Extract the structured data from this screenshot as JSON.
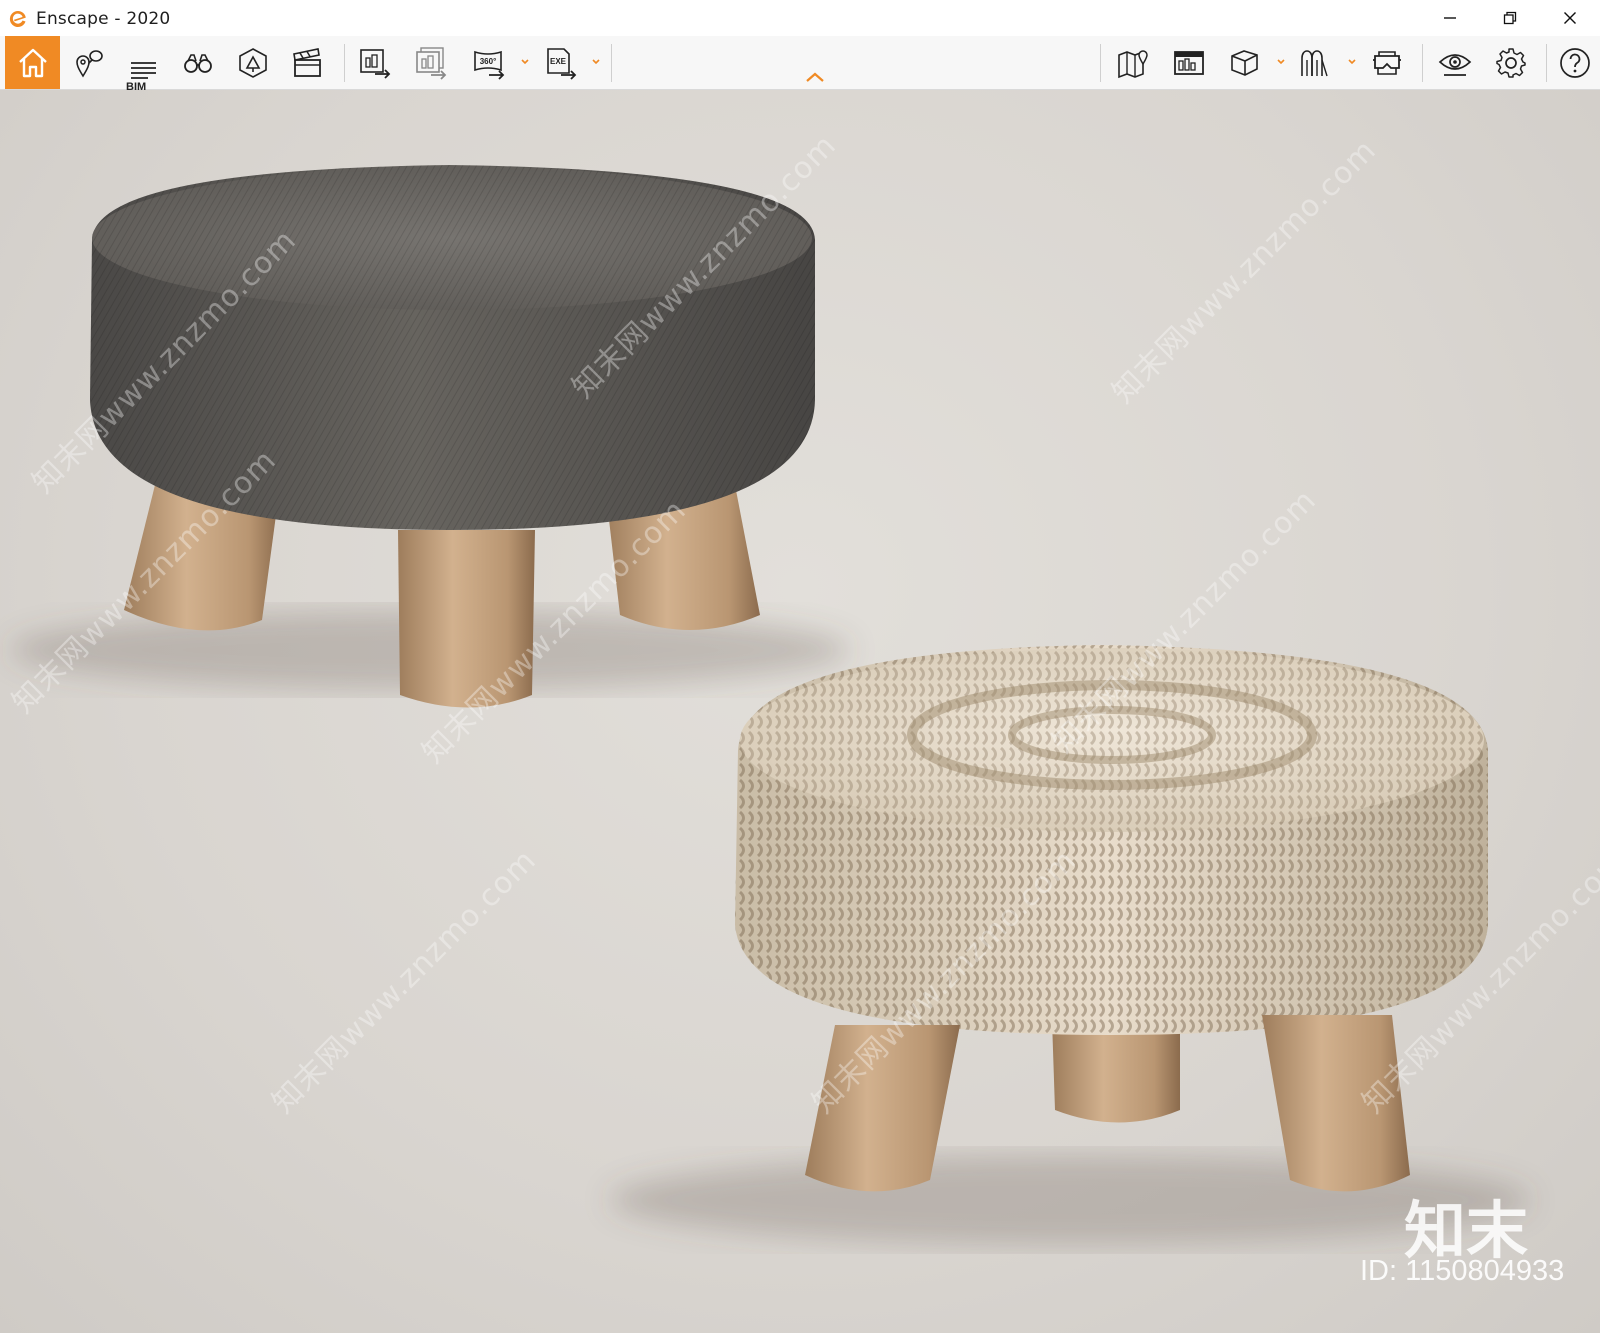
{
  "window": {
    "title": "Enscape - 2020",
    "accent_color": "#f08a24",
    "controls": [
      "minimize-icon",
      "restore-icon",
      "close-icon"
    ]
  },
  "toolbar": {
    "bim_label": "BIM",
    "left_tools": [
      {
        "name": "home",
        "icon": "home-icon",
        "active": true
      },
      {
        "name": "views",
        "icon": "location-pin-icon"
      },
      {
        "name": "bim",
        "icon": "bim-list-icon"
      },
      {
        "name": "binoculars",
        "icon": "binoculars-icon"
      },
      {
        "name": "asset-library",
        "icon": "asset-library-icon"
      },
      {
        "name": "video-editor",
        "icon": "clapperboard-icon"
      }
    ],
    "export_tools": [
      {
        "name": "render-export",
        "icon": "render-export-icon"
      },
      {
        "name": "batch-render",
        "icon": "batch-render-icon"
      },
      {
        "name": "panorama",
        "icon": "panorama-360-icon",
        "label": "360°",
        "dropdown": true
      },
      {
        "name": "exe-export",
        "icon": "exe-export-icon",
        "label": "EXE",
        "dropdown": true
      }
    ],
    "right_tools": [
      {
        "name": "map",
        "icon": "map-icon"
      },
      {
        "name": "dashboard",
        "icon": "dashboard-icon"
      },
      {
        "name": "cube",
        "icon": "cube-icon",
        "dropdown": true
      },
      {
        "name": "people",
        "icon": "people-icon",
        "dropdown": true
      },
      {
        "name": "vr-headset",
        "icon": "vr-headset-icon"
      },
      {
        "name": "visual-settings",
        "icon": "eye-icon"
      },
      {
        "name": "settings",
        "icon": "gear-icon"
      },
      {
        "name": "help",
        "icon": "help-icon"
      }
    ]
  },
  "watermark": {
    "site_text": "知末网www.znzmo.com",
    "logo_text": "知末",
    "id_text": "ID: 1150804933"
  }
}
